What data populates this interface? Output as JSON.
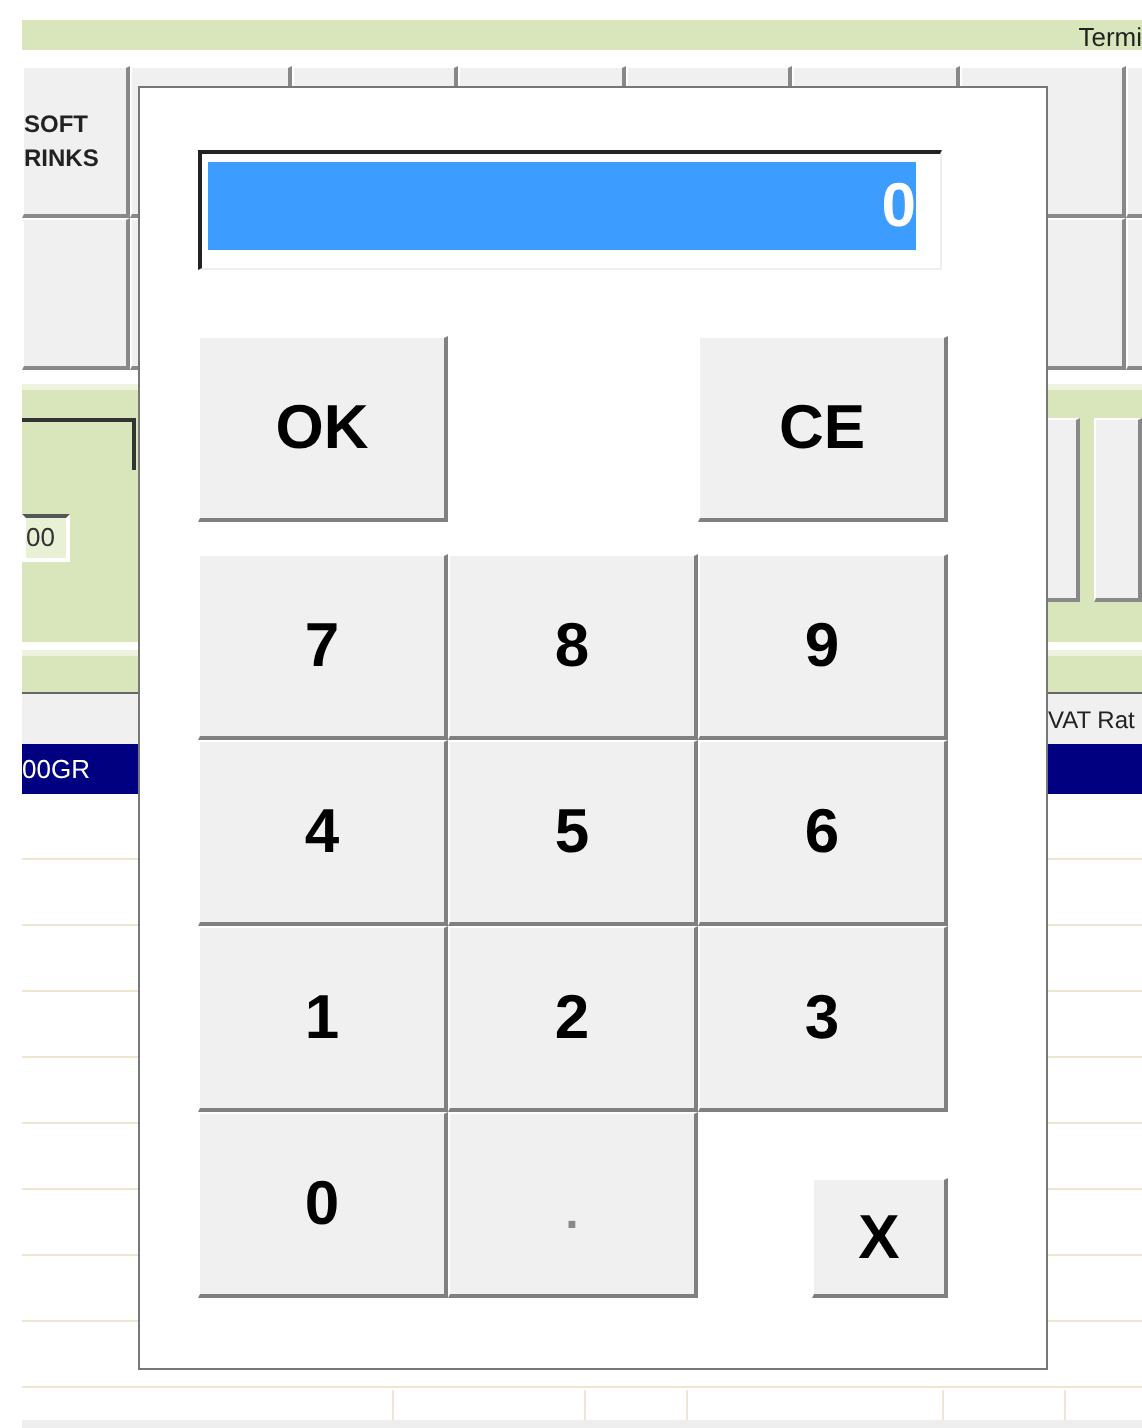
{
  "top_bar": {
    "text": "Termi"
  },
  "category_buttons": [
    {
      "lines": [
        "SOFT",
        "RINKS"
      ]
    }
  ],
  "order_panel": {
    "quantity_field": {
      "value": "00"
    }
  },
  "table": {
    "columns": [
      {
        "header": "VAT Rat"
      }
    ],
    "rows": [
      {
        "column_1": "00GR",
        "selected": true
      }
    ]
  },
  "keypad_dialog": {
    "display": {
      "value": "0",
      "selected": true
    },
    "actions": [
      "OK",
      "CE"
    ],
    "keys": [
      "7",
      "8",
      "9",
      "4",
      "5",
      "6",
      "1",
      "2",
      "3",
      "0",
      "."
    ],
    "close": "X"
  }
}
